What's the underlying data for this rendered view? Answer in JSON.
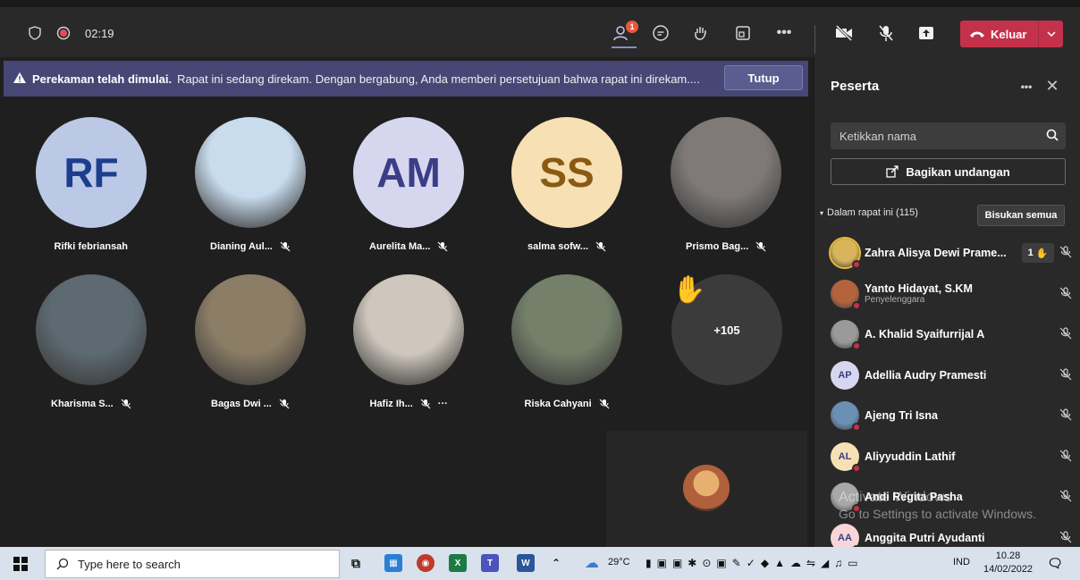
{
  "topbar": {
    "timer": "02:19",
    "participants_badge": "1",
    "leave_label": "Keluar"
  },
  "banner": {
    "title": "Perekaman telah dimulai.",
    "message": "Rapat ini sedang direkam. Dengan bergabung, Anda memberi persetujuan bahwa rapat ini direkam....",
    "close_label": "Tutup"
  },
  "tiles": [
    {
      "name": "Rifki febriansah",
      "initials": "RF",
      "bg": "#bcc9e6",
      "fg": "#1d3d8f",
      "muted": false
    },
    {
      "name": "Dianing Aul...",
      "initials": "",
      "bg": "#c8dcee",
      "fg": "#fff",
      "muted": true
    },
    {
      "name": "Aurelita Ma...",
      "initials": "AM",
      "bg": "#d6d7ef",
      "fg": "#3b3e86",
      "muted": true
    },
    {
      "name": "salma sofw...",
      "initials": "SS",
      "bg": "#f6e0b4",
      "fg": "#8a5a13",
      "muted": true
    },
    {
      "name": "Prismo Bag...",
      "initials": "",
      "bg": "#7f7a78",
      "fg": "#fff",
      "muted": true
    },
    {
      "name": "Kharisma S...",
      "initials": "",
      "bg": "#5d6a72",
      "fg": "#fff",
      "muted": true
    },
    {
      "name": "Bagas Dwi ...",
      "initials": "",
      "bg": "#8b7d66",
      "fg": "#fff",
      "muted": true
    },
    {
      "name": "Hafiz Ih...",
      "initials": "",
      "bg": "#cfc7bd",
      "fg": "#fff",
      "muted": true
    },
    {
      "name": "Riska Cahyani",
      "initials": "",
      "bg": "#74806a",
      "fg": "#fff",
      "muted": true
    }
  ],
  "overflow_tile": {
    "label": "+105"
  },
  "panel": {
    "title": "Peserta",
    "search_placeholder": "Ketikkan nama",
    "invite_label": "Bagikan undangan",
    "section_label": "Dalam rapat ini (115)",
    "mute_all_label": "Bisukan semua",
    "people": [
      {
        "name": "Zahra Alisya Dewi Prame...",
        "role": "",
        "initials": "",
        "bg": "#d9b45a",
        "hand": "1"
      },
      {
        "name": "Yanto Hidayat, S.KM",
        "role": "Penyelenggara",
        "initials": "",
        "bg": "#b4643c",
        "hand": ""
      },
      {
        "name": "A. Khalid Syaifurrijal A",
        "role": "",
        "initials": "",
        "bg": "#9a9a9a",
        "hand": ""
      },
      {
        "name": "Adellia Audry Pramesti",
        "role": "",
        "initials": "AP",
        "bg": "#d6d7ef",
        "hand": ""
      },
      {
        "name": "Ajeng Tri Isna",
        "role": "",
        "initials": "",
        "bg": "#6b8fb5",
        "hand": ""
      },
      {
        "name": "Aliyyuddin Lathif",
        "role": "",
        "initials": "AL",
        "bg": "#f6e0b4",
        "hand": ""
      },
      {
        "name": "Andi Regita Pasha",
        "role": "",
        "initials": "",
        "bg": "#a8a8a8",
        "hand": ""
      },
      {
        "name": "Anggita Putri Ayudanti",
        "role": "",
        "initials": "AA",
        "bg": "#f6d6d6",
        "hand": ""
      }
    ]
  },
  "watermark": {
    "line1": "Activate Windows",
    "line2": "Go to Settings to activate Windows."
  },
  "taskbar": {
    "search_placeholder": "Type here to search",
    "temperature": "29°C",
    "language": "IND",
    "time": "10.28",
    "date": "14/02/2022"
  }
}
